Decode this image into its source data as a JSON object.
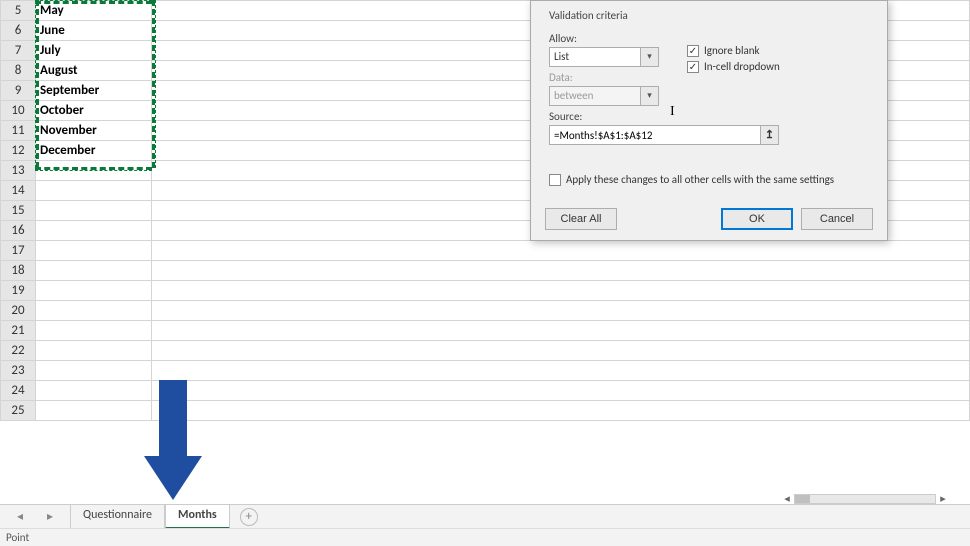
{
  "rows": [
    {
      "num": 5,
      "val": "May"
    },
    {
      "num": 6,
      "val": "June"
    },
    {
      "num": 7,
      "val": "July"
    },
    {
      "num": 8,
      "val": "August"
    },
    {
      "num": 9,
      "val": "September"
    },
    {
      "num": 10,
      "val": "October"
    },
    {
      "num": 11,
      "val": "November"
    },
    {
      "num": 12,
      "val": "December"
    },
    {
      "num": 13,
      "val": ""
    },
    {
      "num": 14,
      "val": ""
    },
    {
      "num": 15,
      "val": ""
    },
    {
      "num": 16,
      "val": ""
    },
    {
      "num": 17,
      "val": ""
    },
    {
      "num": 18,
      "val": ""
    },
    {
      "num": 19,
      "val": ""
    },
    {
      "num": 20,
      "val": ""
    },
    {
      "num": 21,
      "val": ""
    },
    {
      "num": 22,
      "val": ""
    },
    {
      "num": 23,
      "val": ""
    },
    {
      "num": 24,
      "val": ""
    },
    {
      "num": 25,
      "val": ""
    }
  ],
  "tabs": {
    "questionnaire": "Questionnaire",
    "months": "Months"
  },
  "status": "Point",
  "dialog": {
    "group": "Validation criteria",
    "allow_label": "Allow:",
    "allow_value": "List",
    "data_label": "Data:",
    "data_value": "between",
    "source_label": "Source:",
    "source_value": "=Months!$A$1:$A$12",
    "ignore_blank": "Ignore blank",
    "incell_dropdown": "In-cell dropdown",
    "apply_all": "Apply these changes to all other cells with the same settings",
    "clear_all": "Clear All",
    "ok": "OK",
    "cancel": "Cancel"
  }
}
